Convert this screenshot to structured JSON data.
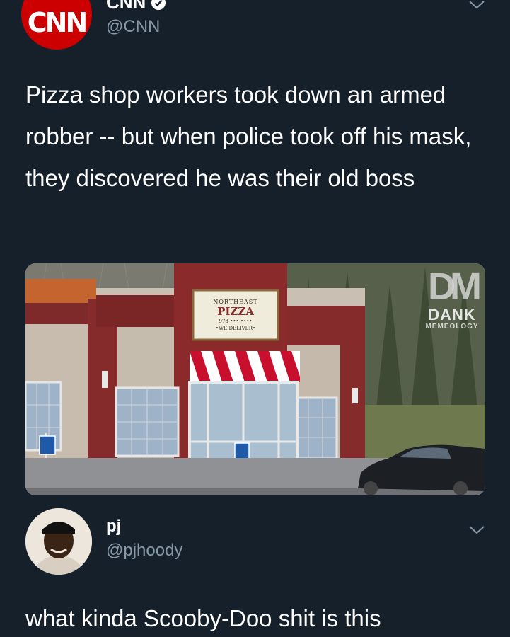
{
  "original_tweet": {
    "author": {
      "logo_text": "CNN",
      "display_name": "CNN",
      "handle": "@CNN",
      "verified": true
    },
    "text": "Pizza shop workers took down an armed robber -- but when police took off his mask, they discovered he was their old boss",
    "photo": {
      "sign_lines": [
        "NORTHEAST",
        "PIZZA",
        "978-•••-••••",
        "•WE DELIVER•"
      ],
      "watermark": {
        "mark": "DM",
        "title": "DANK",
        "subtitle": "MEMEOLOGY"
      }
    },
    "menu_icon": "chevron-down-icon"
  },
  "reply": {
    "display_name": "pj",
    "handle": "@pjhoody",
    "text": "what kinda Scooby-Doo shit is this",
    "menu_icon": "chevron-down-icon"
  },
  "colors": {
    "background": "#15202b",
    "secondary_text": "#8899a6",
    "cnn_red": "#cc0000"
  }
}
